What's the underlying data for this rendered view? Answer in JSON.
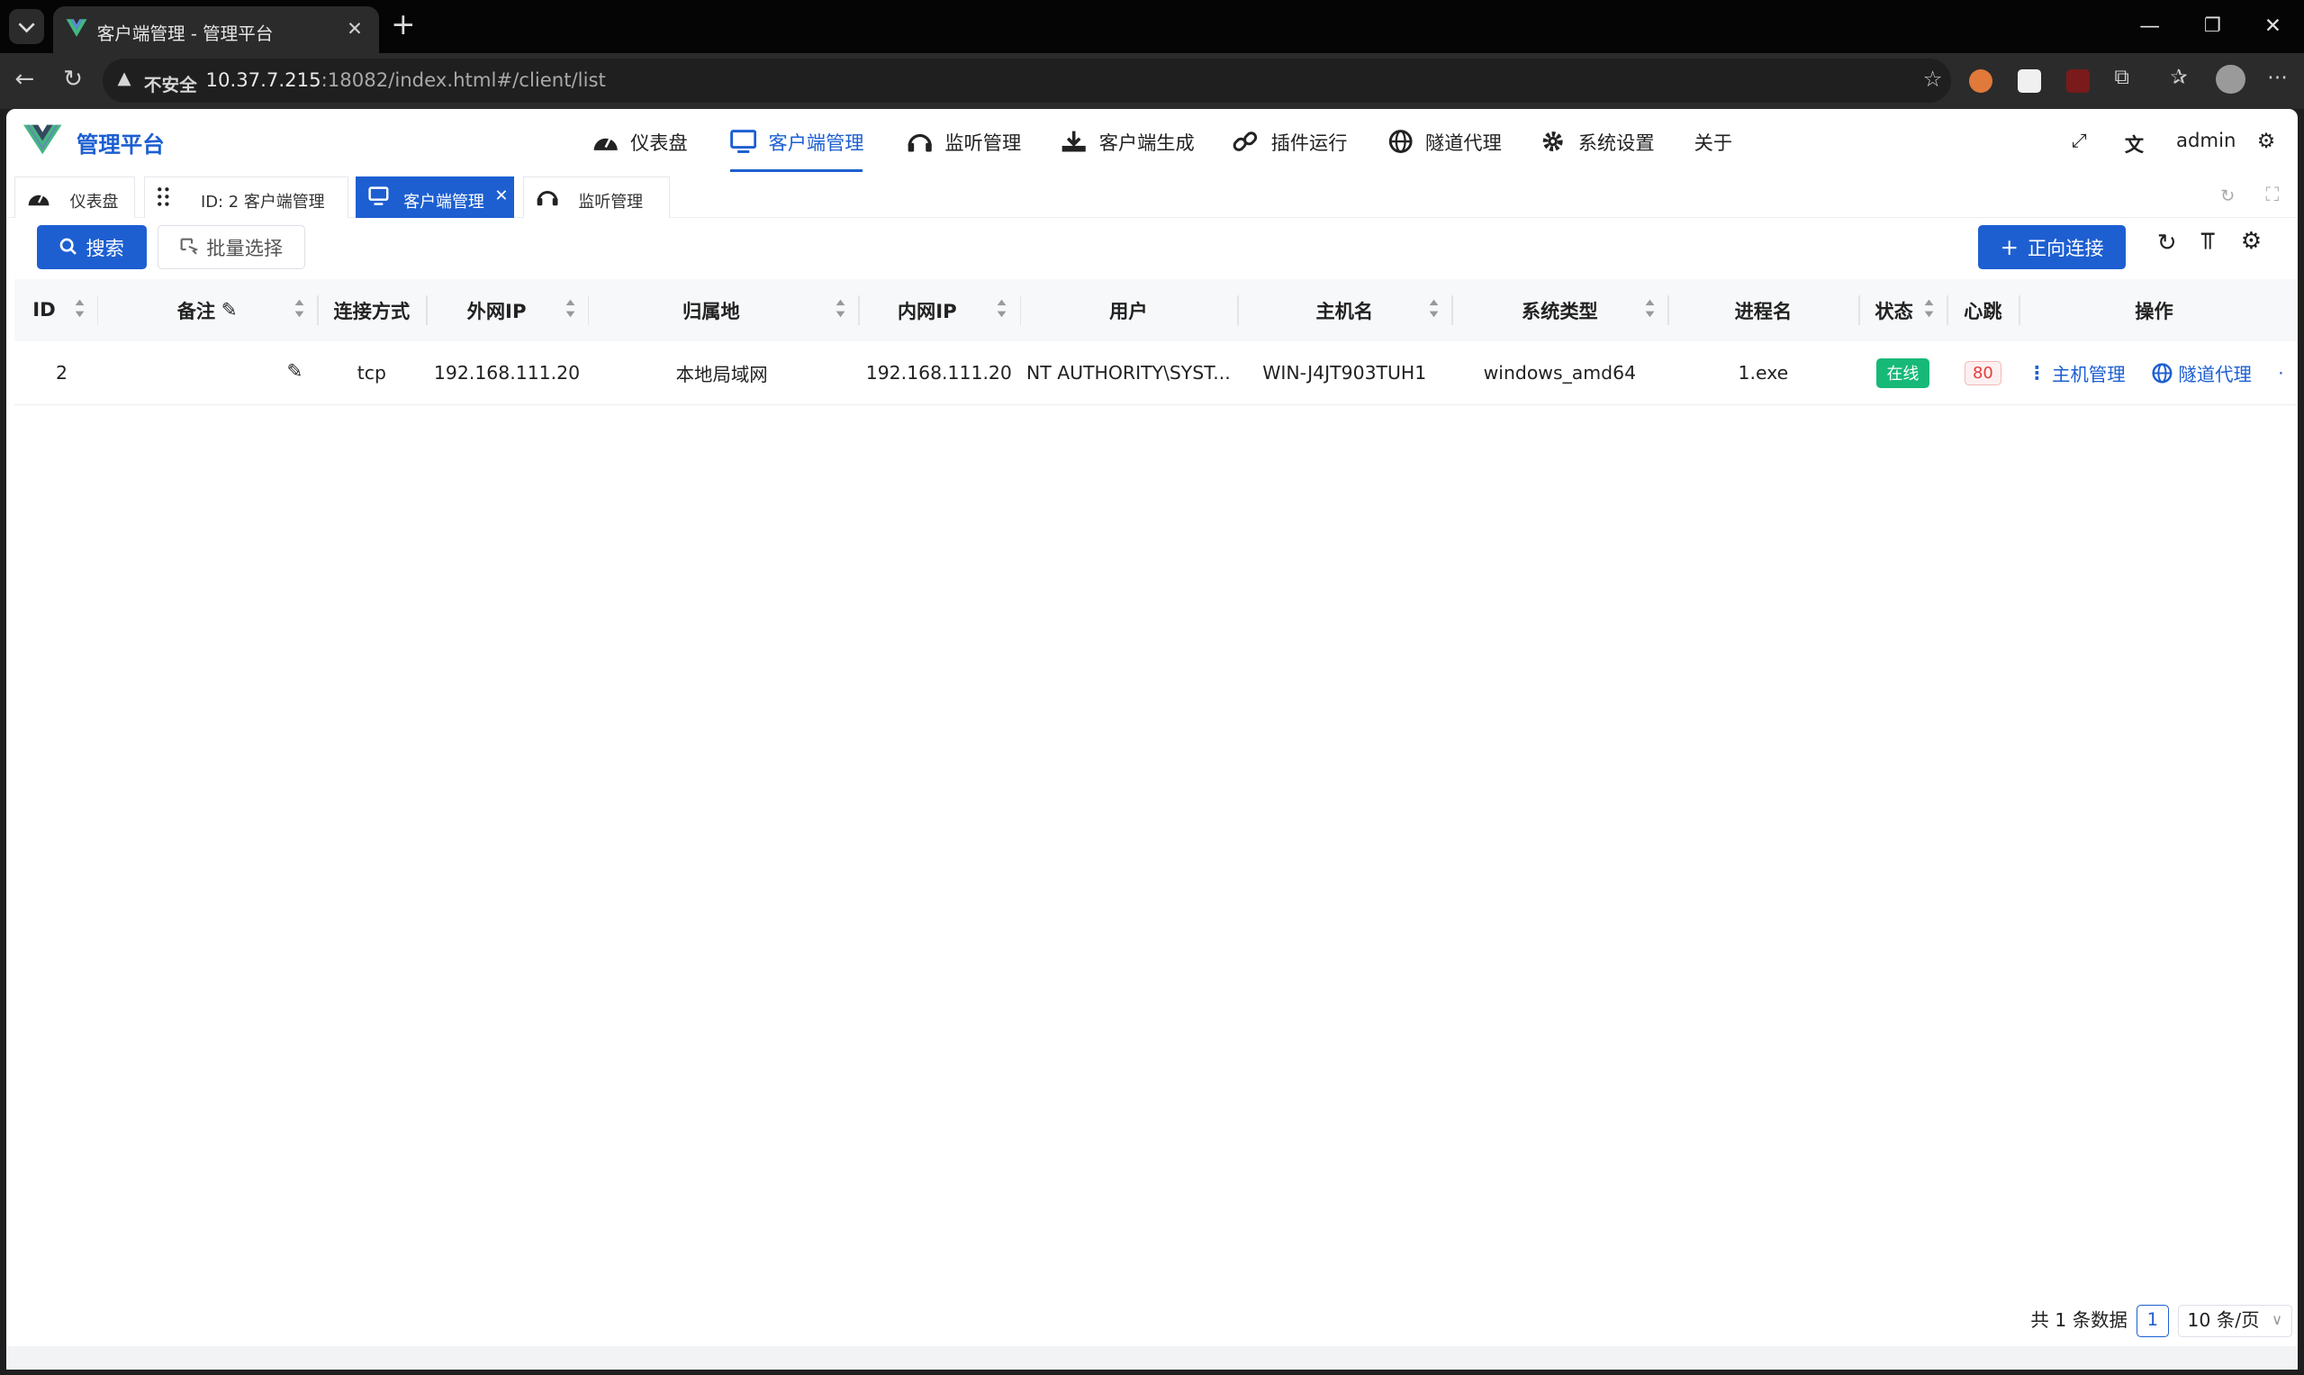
{
  "browser": {
    "tab_title": "客户端管理 - 管理平台",
    "close_glyph": "✕",
    "new_tab_glyph": "+",
    "insecure_label": "不安全",
    "url_host": "10.37.7.215",
    "url_rest": ":18082/index.html#/client/list"
  },
  "app": {
    "brand": "管理平台",
    "menu": [
      {
        "label": "仪表盘",
        "icon": "dashboard-icon"
      },
      {
        "label": "客户端管理",
        "icon": "monitor-icon"
      },
      {
        "label": "监听管理",
        "icon": "headphones-icon"
      },
      {
        "label": "客户端生成",
        "icon": "download-icon"
      },
      {
        "label": "插件运行",
        "icon": "link-icon"
      },
      {
        "label": "隧道代理",
        "icon": "globe-icon"
      },
      {
        "label": "系统设置",
        "icon": "gear-icon"
      },
      {
        "label": "关于",
        "icon": ""
      }
    ],
    "user": "admin"
  },
  "page_tabs": [
    {
      "label": "仪表盘",
      "icon": "dashboard-icon"
    },
    {
      "label": "ID: 2 客户端管理",
      "icon": "grip-icon"
    },
    {
      "label": "客户端管理",
      "icon": "monitor-icon",
      "active": true
    },
    {
      "label": "监听管理",
      "icon": "headphones-icon"
    }
  ],
  "toolbar": {
    "search_label": "搜索",
    "batch_label": "批量选择",
    "connect_label": "正向连接"
  },
  "table": {
    "columns": [
      "ID",
      "备注",
      "连接方式",
      "外网IP",
      "归属地",
      "内网IP",
      "用户",
      "主机名",
      "系统类型",
      "进程名",
      "状态",
      "心跳",
      "操作"
    ],
    "rows": [
      {
        "id": "2",
        "remark": "",
        "conn": "tcp",
        "wan_ip": "192.168.111.20",
        "location": "本地局域网",
        "lan_ip": "192.168.111.20",
        "user": "NT AUTHORITY\\SYST...",
        "hostname": "WIN-J4JT903TUH1",
        "os": "windows_amd64",
        "process": "1.exe",
        "status": "在线",
        "heartbeat": "80",
        "actions": [
          "主机管理",
          "隧道代理"
        ]
      }
    ]
  },
  "pagination": {
    "total_text": "共 1 条数据",
    "current_page": "1",
    "page_size": "10 条/页"
  },
  "colors": {
    "accent": "#1d5fd1",
    "online": "#16b978",
    "heartbeat": "#e23c3c"
  }
}
